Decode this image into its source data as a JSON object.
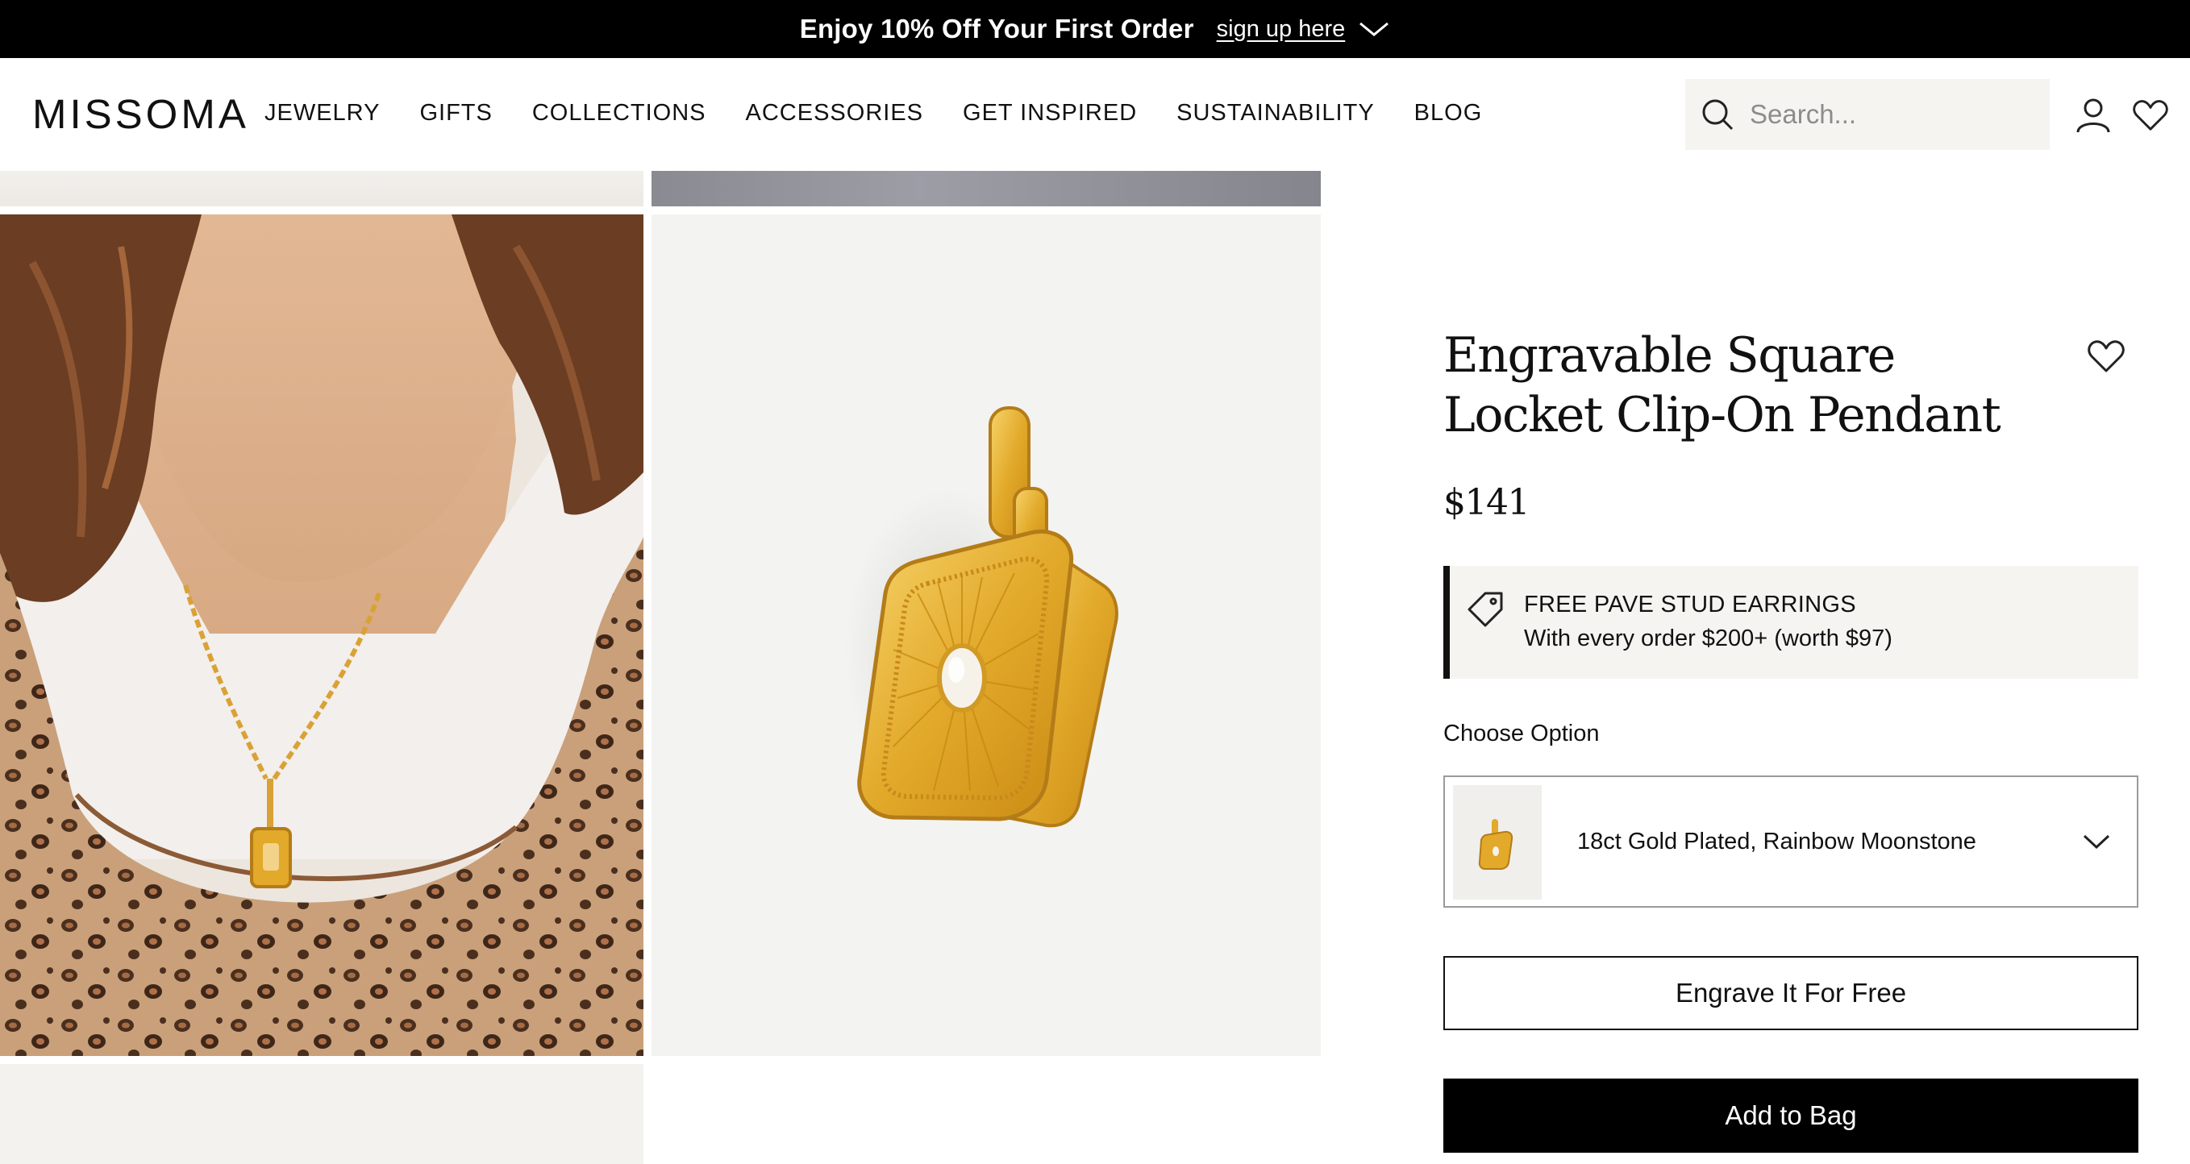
{
  "promo": {
    "text": "Enjoy 10% Off Your First Order",
    "link": "sign up here",
    "icon": "chevron-down-icon"
  },
  "header": {
    "logo": "MISSOMA",
    "nav": [
      "JEWELRY",
      "GIFTS",
      "COLLECTIONS",
      "ACCESSORIES",
      "GET INSPIRED",
      "SUSTAINABILITY",
      "BLOG"
    ],
    "search_placeholder": "Search...",
    "icons": [
      "search-icon",
      "account-icon",
      "heart-icon"
    ]
  },
  "gallery": {
    "images": [
      "model-wearing-necklace-photo",
      "locket-pendant-product-photo"
    ]
  },
  "product": {
    "title": "Engravable Square Locket Clip-On Pendant",
    "price": "$141",
    "offer": {
      "title": "FREE PAVE STUD EARRINGS",
      "subtitle": "With every order $200+ (worth $97)"
    },
    "choose_label": "Choose Option",
    "selected_option": "18ct Gold Plated, Rainbow Moonstone",
    "engrave_label": "Engrave It For Free",
    "add_to_bag_label": "Add to Bag"
  },
  "colors": {
    "black": "#000000",
    "light_panel": "#f5f4f1",
    "gold": "#e2a92a"
  }
}
